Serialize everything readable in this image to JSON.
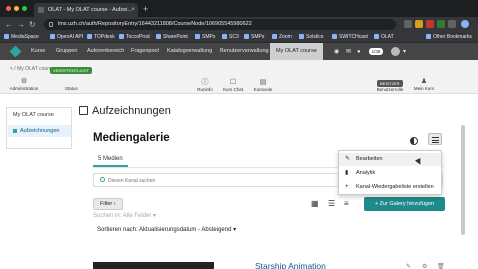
{
  "browser": {
    "tab_title": "OLAT - My OLAT course - Aufzei...",
    "url": "lms.uzh.ch/auth/RepositoryEntry/16443211808/CourseNode/106905545980622",
    "new_tab": "+",
    "bookmarks": [
      "MediaSpace",
      "OpenAI API",
      "TOPdesk",
      "ToccoProd",
      "SharePoint",
      "SMPs",
      "SC3",
      "SMPs",
      "Zoom",
      "Solstice",
      "SWITCHcast",
      "OLAT"
    ],
    "other_bookmarks": "Other Bookmarks",
    "colors": {
      "chrome_dark": "#1d1e20",
      "chrome": "#35363a"
    }
  },
  "olat_nav": {
    "items": [
      "Kurse",
      "Gruppen",
      "Autorenbereich",
      "Fragenpool",
      "Katalogverwaltung",
      "Benutzerverwaltung",
      "My OLAT course"
    ],
    "notifications_count": "1/38",
    "accent": "#2ba6a0"
  },
  "toolbar": {
    "breadcrumb": "< / My OLAT course",
    "administration": "Administration",
    "status_badge": "VERÖFFENTLICHT",
    "status_label": "Status",
    "tools": [
      "Runinfo",
      "Kurs Chat",
      "Konsoole"
    ],
    "role_badge": "BESITZER",
    "role_label": "Benutzerrolle",
    "my_course": "Mein Kurs"
  },
  "left_menu": {
    "root": "My OLAT course",
    "child": "Aufzeichnungen"
  },
  "main": {
    "page_title": "Aufzeichnungen",
    "gallery_title": "Mediengalerie",
    "tab_media": "5 Medien",
    "search_placeholder": "Diesen Kanal suchen",
    "filter_button": "Filter",
    "filter_caret": "›",
    "add_button": "+ Zur Galery hinzufügen",
    "filter_hint": "Suchen in: Alle Felder",
    "sort_line": "Sortieren nach: Aktualisierungsdatum - Absteigend",
    "first_item_title": "Starship Animation",
    "add_button_color": "#1f8a8a"
  },
  "dropdown": {
    "items": [
      "Bearbeiten",
      "Analytik",
      "Kanal-Wiedergabeliste erstellen"
    ]
  }
}
